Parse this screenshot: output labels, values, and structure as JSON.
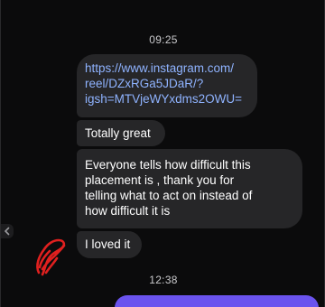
{
  "chat": {
    "timestamp_top": "09:25",
    "timestamp_bottom": "12:38",
    "messages": [
      {
        "type": "link",
        "lines": [
          "https://www.instagram.com/",
          "reel/DZxRGa5JDaR/?",
          "igsh=MTVjeWYxdms2OWU="
        ]
      },
      {
        "type": "text",
        "text": "Totally great"
      },
      {
        "type": "text",
        "lines": [
          "Everyone tells how difficult this",
          "placement is , thank you for",
          "telling what to act on instead of",
          "how difficult it is"
        ]
      },
      {
        "type": "text",
        "text": "I loved it"
      }
    ],
    "colors": {
      "background": "#0b0b0c",
      "incoming_bubble": "#262628",
      "link_text": "#8fb3ff",
      "outgoing_bubble": "#6a53ee",
      "annotation": "#e0201f"
    },
    "icons": {
      "side_arrow": "chevron-left-icon",
      "annotation": "red-scribble-mark"
    }
  }
}
